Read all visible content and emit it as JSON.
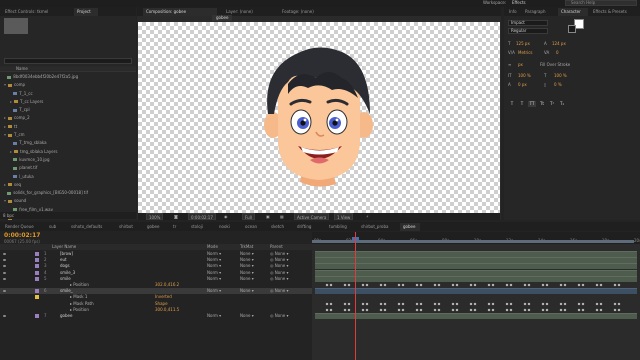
{
  "topbar": {
    "workspace_label": "Workspace:",
    "workspace_value": "Effects",
    "search_placeholder": "Search Help"
  },
  "left_panel": {
    "tabs": [
      "Effect Controls: tkmel",
      "Project"
    ],
    "search_placeholder": "",
    "column_header": "Name",
    "items": [
      {
        "label": "8bdf0034ebb4f20b2e47f2a5.jpg",
        "icon": "image",
        "indent": 0,
        "twirl": ""
      },
      {
        "label": "comp",
        "icon": "folder",
        "indent": 0,
        "twirl": "▾"
      },
      {
        "label": "T_1_cc",
        "icon": "comp",
        "indent": 1,
        "twirl": ""
      },
      {
        "label": "T_cc Layers",
        "icon": "folder",
        "indent": 1,
        "twirl": "▸"
      },
      {
        "label": "T_cpl",
        "icon": "comp",
        "indent": 1,
        "twirl": ""
      },
      {
        "label": "comp_2",
        "icon": "folder",
        "indent": 0,
        "twirl": "▸"
      },
      {
        "label": "tt",
        "icon": "folder",
        "indent": 0,
        "twirl": "▸"
      },
      {
        "label": "T_cm",
        "icon": "folder",
        "indent": 0,
        "twirl": "▾"
      },
      {
        "label": "T_tmg_sblaka",
        "icon": "comp",
        "indent": 1,
        "twirl": ""
      },
      {
        "label": "tmg_sblaka Layers",
        "icon": "folder",
        "indent": 1,
        "twirl": "▸"
      },
      {
        "label": "kuvmce_10.jpg",
        "icon": "image",
        "indent": 1,
        "twirl": ""
      },
      {
        "label": "planet.tif",
        "icon": "image",
        "indent": 1,
        "twirl": ""
      },
      {
        "label": "l_utuka",
        "icon": "comp",
        "indent": 1,
        "twirl": ""
      },
      {
        "label": "seq",
        "icon": "folder",
        "indent": 0,
        "twirl": "▸"
      },
      {
        "label": "solids_for_graphics_[BIG50-00018] tif",
        "icon": "image",
        "indent": 0,
        "twirl": ""
      },
      {
        "label": "sound",
        "icon": "folder",
        "indent": 0,
        "twirl": "▾"
      },
      {
        "label": "free_film_v1.wav",
        "icon": "image",
        "indent": 1,
        "twirl": ""
      },
      {
        "label": "video",
        "icon": "folder",
        "indent": 0,
        "twirl": "▸"
      }
    ],
    "footer": "8 bpc"
  },
  "comp_panel": {
    "tabs": [
      "Composition: gobee",
      "Layer: (none)",
      "Footage: (none)"
    ],
    "breadcrumb": "gobee",
    "viewer": {
      "zoom": "100%",
      "timecode": "0:00:02:17",
      "resolution": "Full",
      "camera": "Active Camera",
      "views": "1 View"
    }
  },
  "right_panel": {
    "tabs": [
      "Info",
      "Paragraph",
      "Character",
      "Effects & Presets"
    ],
    "font_family": "Impact",
    "font_style": "Regular",
    "font_size": "125 px",
    "leading": "124 px",
    "kerning": "Metrics",
    "tracking": "0",
    "stroke_width": "px",
    "stroke_type": "Fill Over Stroke",
    "vert_scale": "100 %",
    "horiz_scale": "100 %",
    "baseline": "0 px",
    "tsume": "0 %",
    "type_buttons": [
      "T",
      "T",
      "TT",
      "Tt",
      "T¹",
      "T₁"
    ]
  },
  "timeline": {
    "tabs": [
      "Render Queue",
      "sub",
      "sshoto_defaults",
      "shirbot",
      "gobee",
      "tr",
      "stoloji",
      "nooki",
      "ocean",
      "sketch",
      "drifting",
      "tumbling",
      "shirbot_proba",
      "gobee"
    ],
    "timecode": "0:00:02:17",
    "fps": "00067 (25.00 fps)",
    "column_header": "Layer Name",
    "mode_header": "Mode",
    "trkmat_header": "TrkMat",
    "parent_header": "Parent",
    "layers": [
      {
        "num": "1",
        "name": "[brow]",
        "value": "",
        "mode": "Norm",
        "trk": "None",
        "parent": "None",
        "label_color": "#9a7fc0",
        "selected": false,
        "sub": false
      },
      {
        "num": "2",
        "name": "eut",
        "value": "",
        "mode": "Norm",
        "trk": "None",
        "parent": "None",
        "label_color": "#9a7fc0",
        "selected": false,
        "sub": false
      },
      {
        "num": "3",
        "name": "dogs",
        "value": "",
        "mode": "Norm",
        "trk": "None",
        "parent": "None",
        "label_color": "#9a7fc0",
        "selected": false,
        "sub": false
      },
      {
        "num": "4",
        "name": "smile_3",
        "value": "",
        "mode": "Norm",
        "trk": "None",
        "parent": "None",
        "label_color": "#9a7fc0",
        "selected": false,
        "sub": false
      },
      {
        "num": "5",
        "name": "smile",
        "value": "",
        "mode": "Norm",
        "trk": "None",
        "parent": "None",
        "label_color": "#9a7fc0",
        "selected": false,
        "sub": false
      },
      {
        "num": "",
        "name": "Position",
        "value": "302.0,416.2",
        "mode": "",
        "trk": "",
        "parent": "",
        "label_color": "",
        "selected": false,
        "sub": true
      },
      {
        "num": "6",
        "name": "smile_",
        "value": "",
        "mode": "Norm",
        "trk": "None",
        "parent": "None",
        "label_color": "#9a7fc0",
        "selected": true,
        "sub": false
      },
      {
        "num": "",
        "name": "Mask 1",
        "value": "Inverted",
        "mode": "",
        "trk": "",
        "parent": "",
        "label_color": "#e0c040",
        "selected": false,
        "sub": true
      },
      {
        "num": "",
        "name": "Mask Path",
        "value": "Shape",
        "mode": "",
        "trk": "",
        "parent": "",
        "label_color": "",
        "selected": false,
        "sub": true
      },
      {
        "num": "",
        "name": "Position",
        "value": "300.0,411.5",
        "mode": "",
        "trk": "",
        "parent": "",
        "label_color": "",
        "selected": false,
        "sub": true
      },
      {
        "num": "7",
        "name": "gobee",
        "value": "",
        "mode": "Norm",
        "trk": "None",
        "parent": "None",
        "label_color": "#9a7fc0",
        "selected": false,
        "sub": false
      }
    ],
    "ruler": [
      "00s",
      "02s",
      "04s",
      "06s",
      "08s",
      "10s",
      "12s",
      "14s",
      "16s",
      "18s",
      "20s"
    ],
    "playhead_fraction": 0.13
  },
  "colors": {
    "accent_orange": "#e09a2a",
    "playhead": "#e03c3c",
    "panel_bg": "#262626"
  }
}
